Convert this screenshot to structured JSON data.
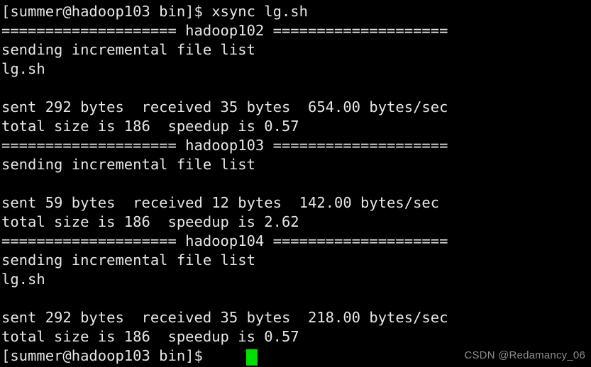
{
  "terminal": {
    "background_color": "#000000",
    "foreground_color": "#e6e6e6",
    "cursor_color": "#00e000",
    "cursor_column": 24,
    "lines": [
      {
        "text": "[summer@hadoop103 bin]$ xsync lg.sh"
      },
      {
        "text": "==================== hadoop102 ===================="
      },
      {
        "text": "sending incremental file list"
      },
      {
        "text": "lg.sh"
      },
      {
        "text": ""
      },
      {
        "text": "sent 292 bytes  received 35 bytes  654.00 bytes/sec"
      },
      {
        "text": "total size is 186  speedup is 0.57"
      },
      {
        "text": "==================== hadoop103 ===================="
      },
      {
        "text": "sending incremental file list"
      },
      {
        "text": ""
      },
      {
        "text": "sent 59 bytes  received 12 bytes  142.00 bytes/sec"
      },
      {
        "text": "total size is 186  speedup is 2.62"
      },
      {
        "text": "==================== hadoop104 ===================="
      },
      {
        "text": "sending incremental file list"
      },
      {
        "text": "lg.sh"
      },
      {
        "text": ""
      },
      {
        "text": "sent 292 bytes  received 35 bytes  218.00 bytes/sec"
      },
      {
        "text": "total size is 186  speedup is 0.57"
      },
      {
        "text": "[summer@hadoop103 bin]$ "
      }
    ]
  },
  "watermark": {
    "text": "CSDN @Redamancy_06",
    "color": "#8c8c8c"
  }
}
